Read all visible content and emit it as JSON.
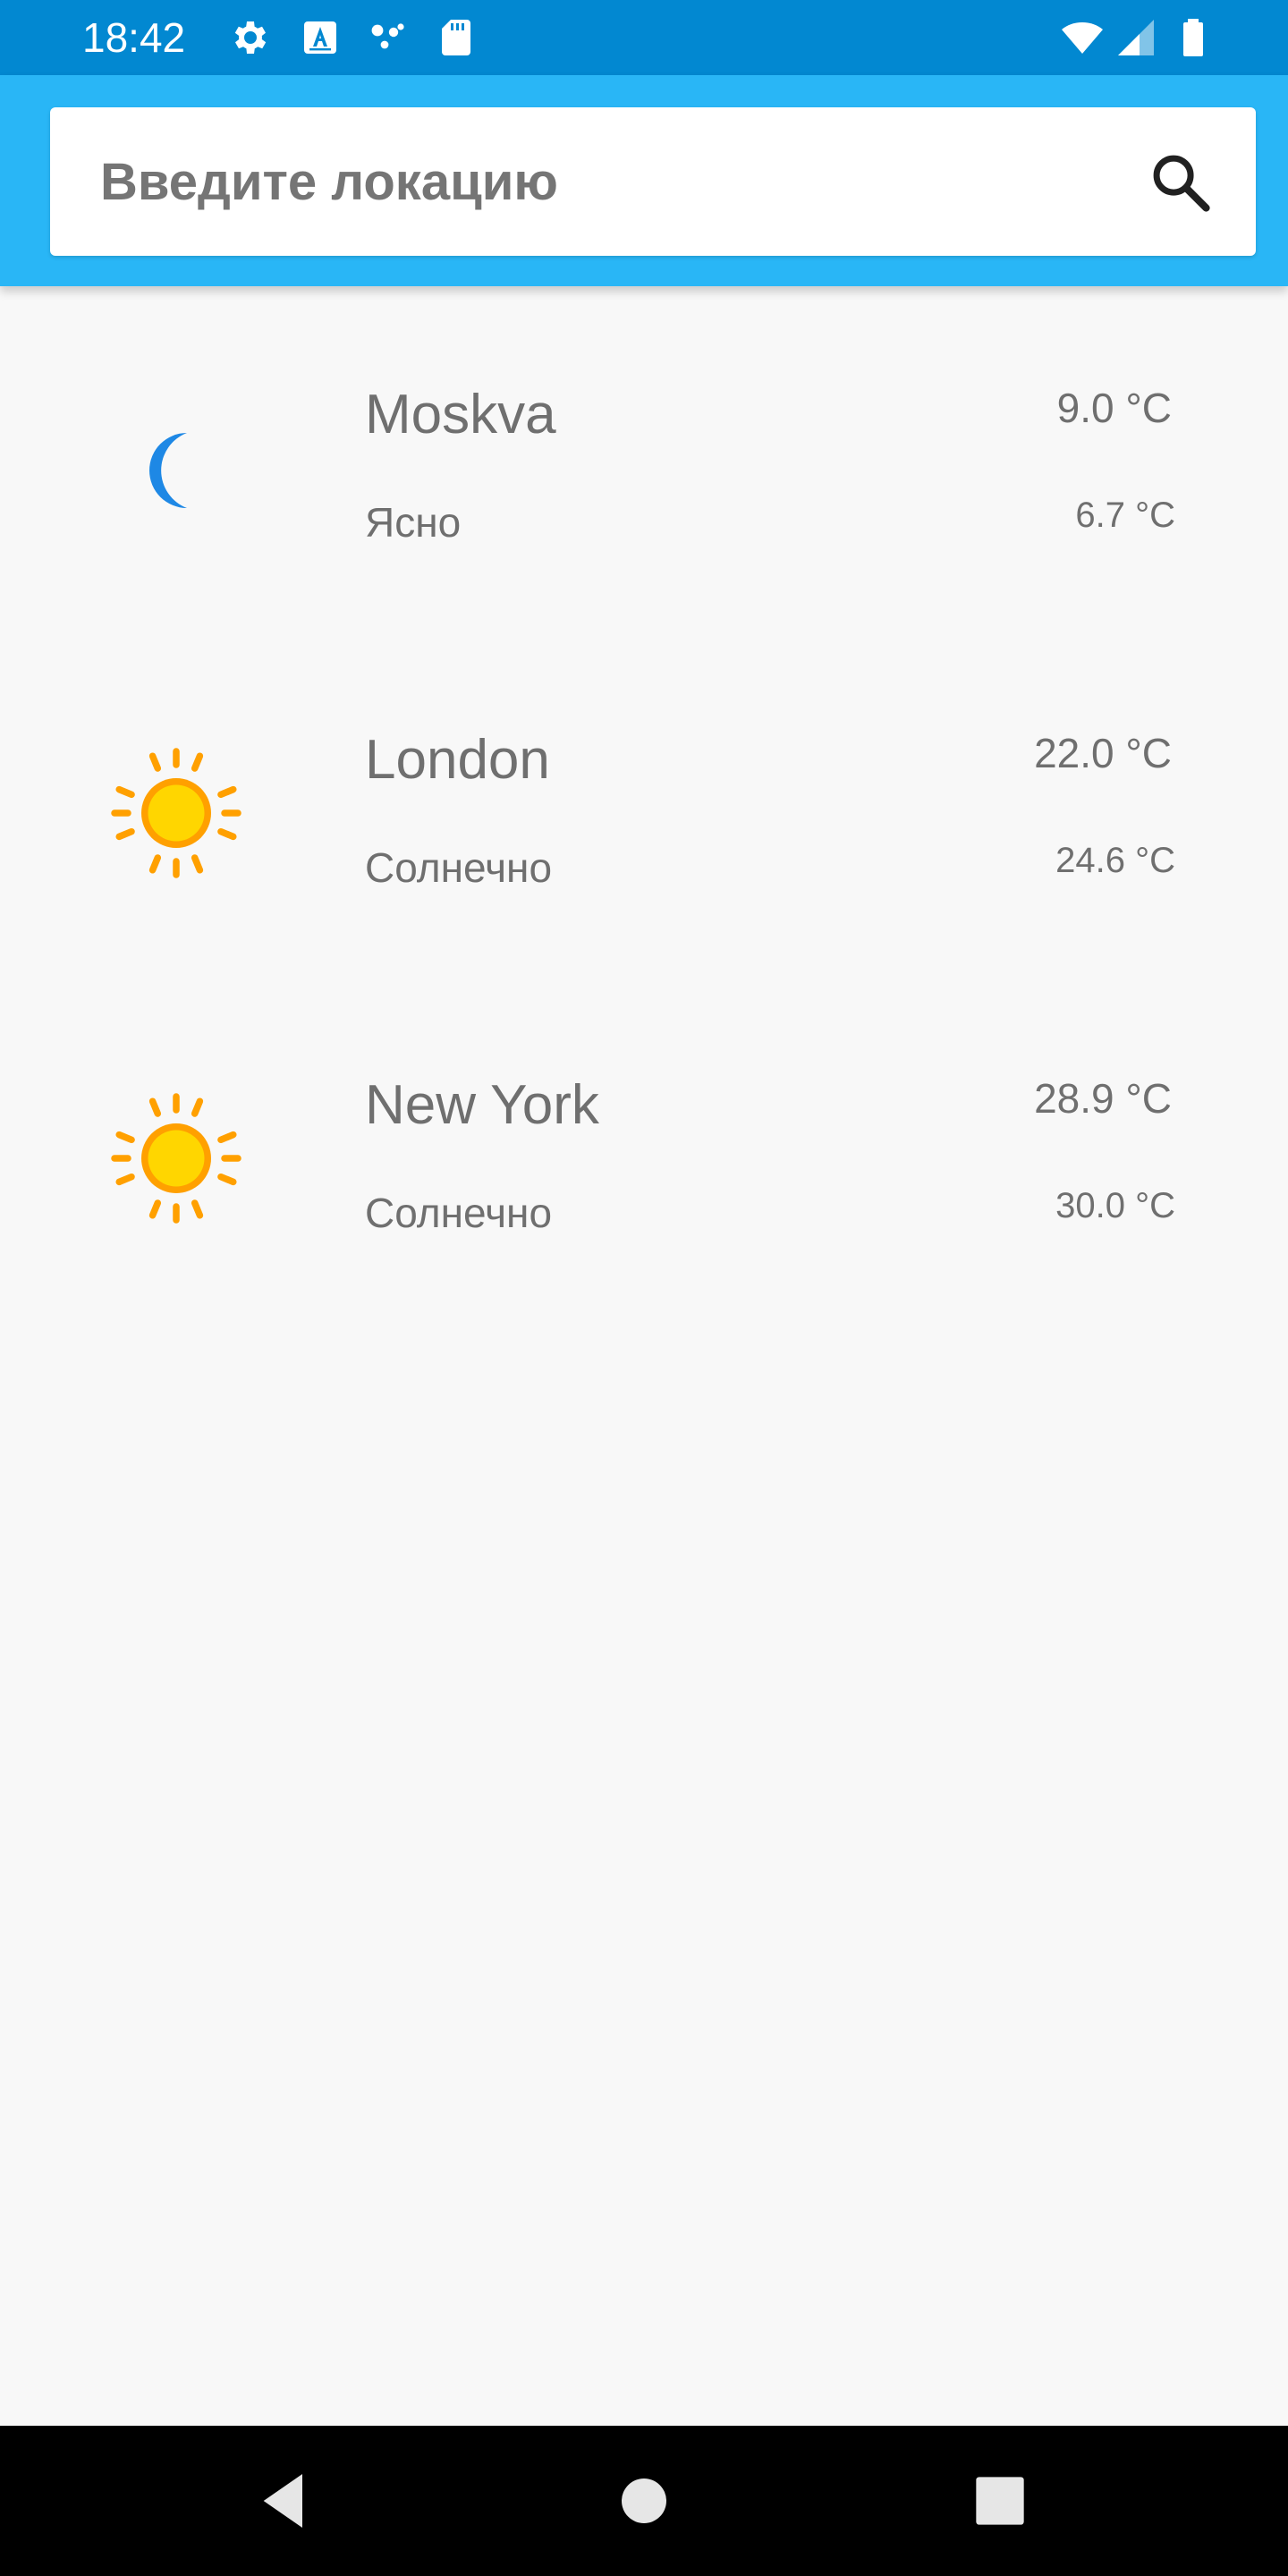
{
  "status_bar": {
    "time": "18:42",
    "icons": [
      "gear-icon",
      "keyboard-a-icon",
      "assistant-dots-icon",
      "sd-card-icon",
      "wifi-icon",
      "cell-signal-icon",
      "battery-icon"
    ],
    "background_color": "#0288d1"
  },
  "app_bar": {
    "background_color": "#29b6f6",
    "search": {
      "placeholder": "Введите локацию",
      "value": "",
      "icon": "search-icon"
    }
  },
  "weather_list": [
    {
      "city": "Moskva",
      "condition": "Ясно",
      "temp": "9.0 °C",
      "feels_like": "6.7 °C",
      "icon": "moon-icon"
    },
    {
      "city": "London",
      "condition": "Солнечно",
      "temp": "22.0 °C",
      "feels_like": "24.6 °C",
      "icon": "sun-icon"
    },
    {
      "city": "New York",
      "condition": "Солнечно",
      "temp": "28.9 °C",
      "feels_like": "30.0 °C",
      "icon": "sun-icon"
    }
  ],
  "nav_bar": {
    "buttons": [
      "back-icon",
      "home-icon",
      "recents-icon"
    ]
  }
}
